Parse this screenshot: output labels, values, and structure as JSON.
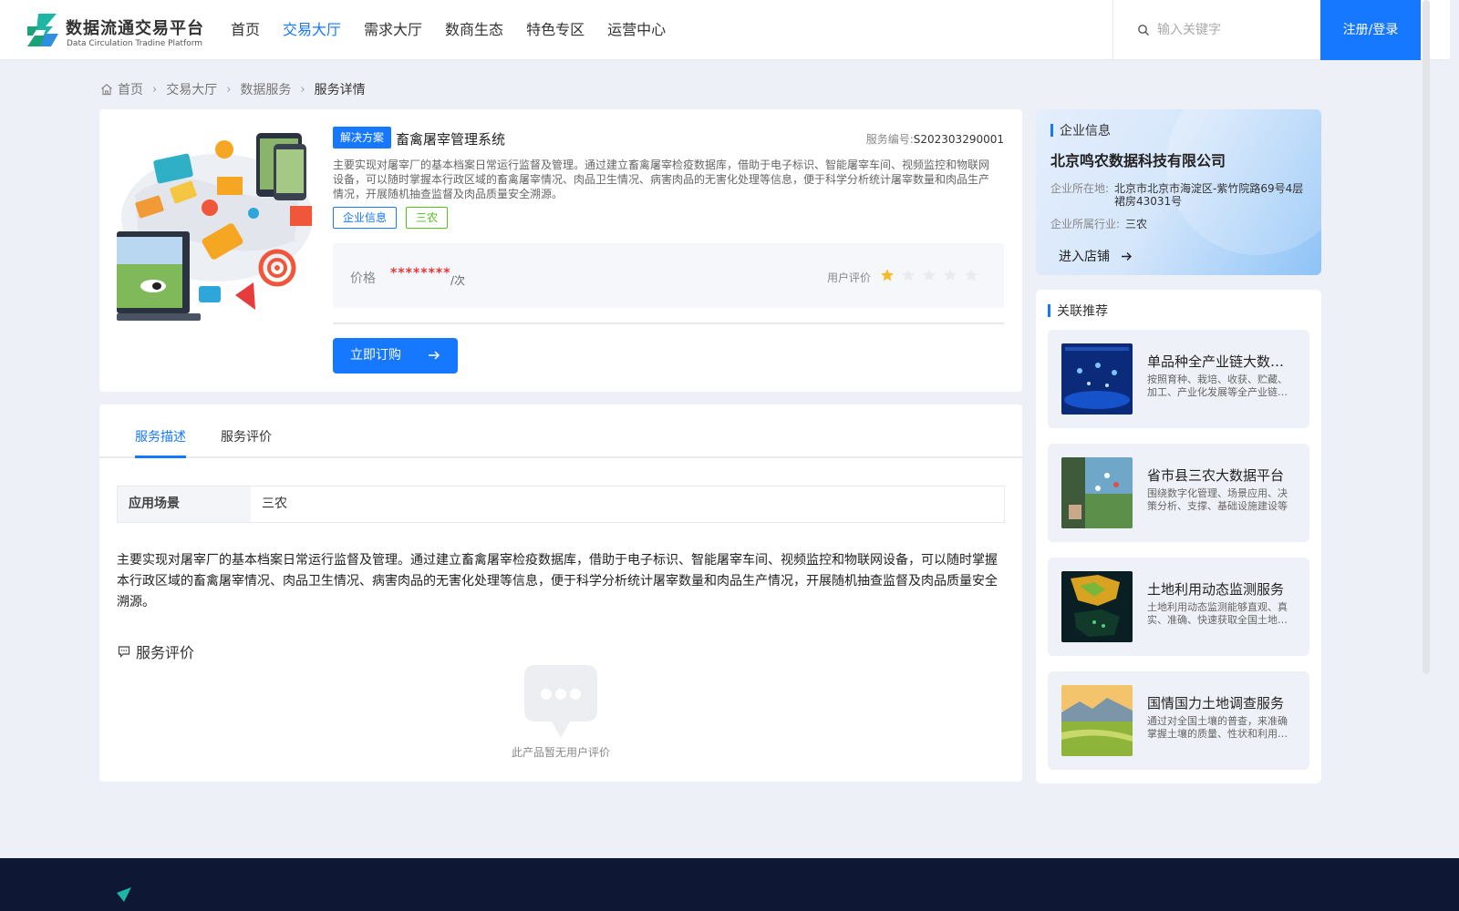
{
  "brand": {
    "title": "数据流通交易平台",
    "subtitle": "Data Circulation Tradine Platform"
  },
  "nav": {
    "items": [
      {
        "label": "首页",
        "active": false
      },
      {
        "label": "交易大厅",
        "active": true
      },
      {
        "label": "需求大厅",
        "active": false
      },
      {
        "label": "数商生态",
        "active": false
      },
      {
        "label": "特色专区",
        "active": false
      },
      {
        "label": "运营中心",
        "active": false
      }
    ]
  },
  "search": {
    "placeholder": "输入关键字",
    "value": ""
  },
  "auth": {
    "login_label": "注册/登录"
  },
  "breadcrumb": {
    "items": [
      "首页",
      "交易大厅",
      "数据服务"
    ],
    "current": "服务详情"
  },
  "product": {
    "badge": "解决方案",
    "title": "畜禽屠宰管理系统",
    "service_no_label": "服务编号:",
    "service_no": "S202303290001",
    "description": "主要实现对屠宰厂的基本档案日常运行监督及管理。通过建立畜禽屠宰检疫数据库，借助于电子标识、智能屠宰车间、视频监控和物联网设备，可以随时掌握本行政区域的畜禽屠宰情况、肉品卫生情况、病害肉品的无害化处理等信息，便于科学分析统计屠宰数量和肉品生产情况，开展随机抽查监督及肉品质量安全溯源。",
    "tags": [
      "企业信息",
      "三农"
    ],
    "price_label": "价格",
    "price_value": "********",
    "price_unit": "/次",
    "rating_label": "用户评价",
    "rating": 1,
    "rating_max": 5,
    "order_label": "立即订购"
  },
  "detail": {
    "tabs": [
      {
        "label": "服务描述",
        "active": true
      },
      {
        "label": "服务评价",
        "active": false
      }
    ],
    "scene_key": "应用场景",
    "scene_value": "三农",
    "long_description": "主要实现对屠宰厂的基本档案日常运行监督及管理。通过建立畜禽屠宰检疫数据库，借助于电子标识、智能屠宰车间、视频监控和物联网设备，可以随时掌握本行政区域的畜禽屠宰情况、肉品卫生情况、病害肉品的无害化处理等信息，便于科学分析统计屠宰数量和肉品生产情况，开展随机抽查监督及肉品质量安全溯源。",
    "review_heading": "服务评价",
    "empty_review_text": "此产品暂无用户评价"
  },
  "company": {
    "heading": "企业信息",
    "name": "北京鸣农数据科技有限公司",
    "location_label": "企业所在地:",
    "location": "北京市北京市海淀区-紫竹院路69号4层裙房43031号",
    "industry_label": "企业所属行业:",
    "industry": "三农",
    "shop_link": "进入店铺"
  },
  "recommend": {
    "heading": "关联推荐",
    "items": [
      {
        "title": "单品种全产业链大数据平台",
        "desc": "按照育种、栽培、收获、贮藏、加工、产业化发展等全产业链环节"
      },
      {
        "title": "省市县三农大数据平台",
        "desc": "围绕数字化管理、场景应用、决策分析、支撑、基础设施建设等"
      },
      {
        "title": "土地利用动态监测服务",
        "desc": "土地利用动态监测能够直观、真实、准确、快速获取全国土地利用"
      },
      {
        "title": "国情国力土地调查服务",
        "desc": "通过对全国土壤的普查，来准确掌握土壤的质量、性状和利用状况"
      }
    ]
  },
  "colors": {
    "accent": "#1677ff",
    "price": "#e2383a",
    "tag_green": "#52c41a",
    "star": "#f7ba2a",
    "footer": "#0e1733"
  },
  "icons": [
    "logo-mark",
    "search-icon",
    "home-icon",
    "chevron-right-icon",
    "arrow-right-icon",
    "star-icon",
    "comment-icon",
    "chat-bubble-icon"
  ]
}
